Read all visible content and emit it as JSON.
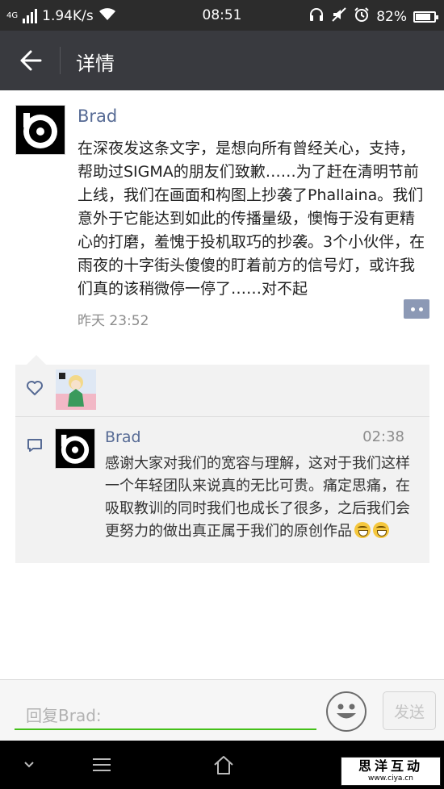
{
  "status_bar": {
    "network": "4G",
    "speed": "1.94K/s",
    "time": "08:51",
    "battery": "82%",
    "battery_fraction": 0.82
  },
  "header": {
    "title": "详情"
  },
  "post": {
    "author": "Brad",
    "text": "在深夜发这条文字，是想向所有曾经关心，支持，帮助过SIGMA的朋友们致歉……为了赶在清明节前上线，我们在画面和构图上抄袭了Phallaina。我们意外于它能达到如此的传播量级，懊悔于没有更精心的打磨，羞愧于投机取巧的抄袭。3个小伙伴，在雨夜的十字街头傻傻的盯着前方的信号灯，或许我们真的该稍微停一停了……对不起",
    "time": "昨天 23:52"
  },
  "comment": {
    "author": "Brad",
    "time": "02:38",
    "text": "感谢大家对我们的宽容与理解，这对于我们这样一个年轻团队来说真的无比可贵。痛定思痛，在吸取教训的同时我们也成长了很多，之后我们会更努力的做出真正属于我们的原创作品"
  },
  "reply_bar": {
    "placeholder": "回复Brad:",
    "send_label": "发送"
  },
  "watermark": {
    "main": "思洋互动",
    "url": "www.ciya.cn"
  },
  "colors": {
    "header_bg": "#393a3f",
    "name_blue": "#576b95",
    "input_green": "#45c01a"
  }
}
